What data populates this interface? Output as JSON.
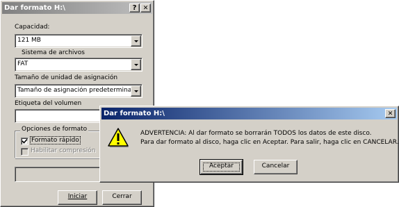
{
  "format_dialog": {
    "title": "Dar formato H:\\",
    "help_glyph": "?",
    "close_glyph": "✕",
    "capacity": {
      "label": "Capacidad:",
      "value": "121 MB"
    },
    "filesystem": {
      "label": "Sistema de archivos",
      "value": "FAT"
    },
    "allocation": {
      "label": "Tamaño de unidad de asignación",
      "value": "Tamaño de asignación predeterminado"
    },
    "volume": {
      "label": "Etiqueta del volumen",
      "value": ""
    },
    "options": {
      "title": "Opciones de formato",
      "quick_format": {
        "label": "Formato rápido",
        "checked": true
      },
      "compression": {
        "label": "Habilitar compresión",
        "checked": false,
        "enabled": false
      }
    },
    "progress": 0,
    "start_button": "Iniciar",
    "close_button": "Cerrar"
  },
  "warning_dialog": {
    "title": "Dar formato H:\\",
    "close_glyph": "✕",
    "icon": "warning-icon",
    "line1": "ADVERTENCIA: Al dar formato se borrarán TODOS los datos de este disco.",
    "line2": "Para dar formato al disco, haga clic en Aceptar. Para salir, haga clic en CANCELAR.",
    "ok_button": "Aceptar",
    "cancel_button": "Cancelar"
  },
  "colors": {
    "title_active": "#0a246a",
    "title_inactive": "#808080",
    "face": "#d4d0c8"
  }
}
